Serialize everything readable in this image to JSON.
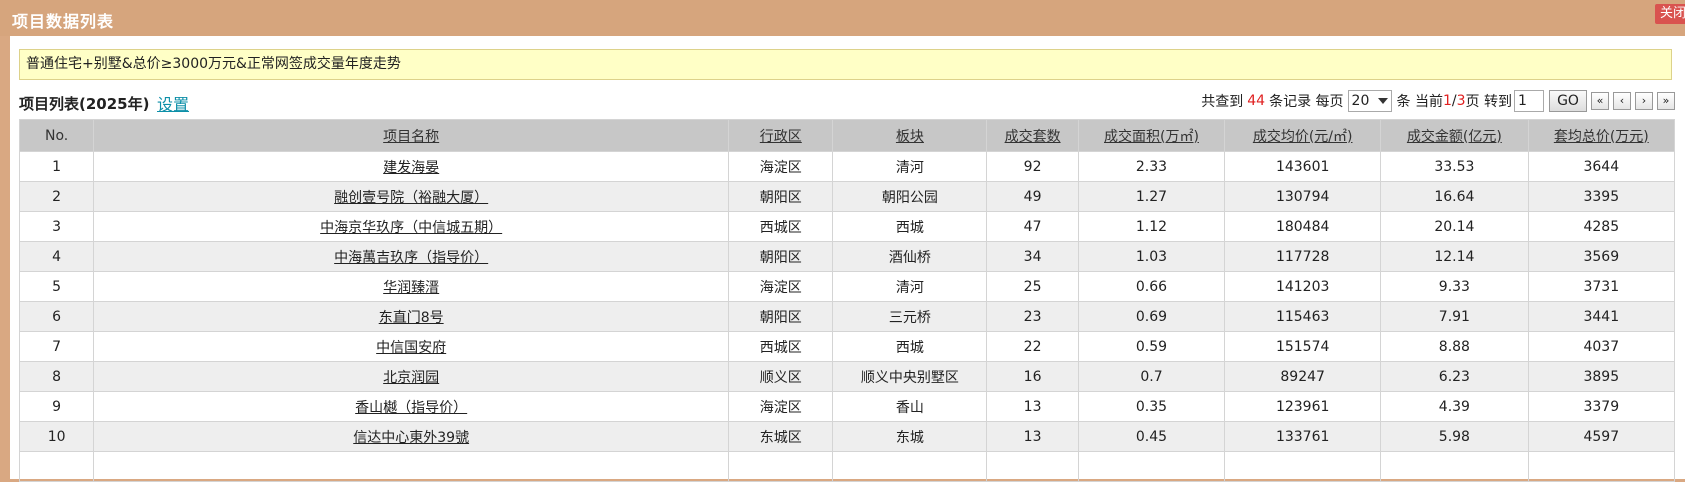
{
  "window": {
    "title": "项目数据列表",
    "close_label": "关闭"
  },
  "subtitle": "普通住宅+别墅&总价≥3000万元&正常网签成交量年度走势",
  "list": {
    "title": "项目列表(2025年)",
    "settings_label": "设置"
  },
  "pager": {
    "found_prefix": "共查到",
    "total": "44",
    "records_suffix": "条记录 每页",
    "per_page": "20",
    "per_page_suffix": "条 当前",
    "current_page": "1",
    "slash": "/",
    "total_pages": "3",
    "page_suffix": "页 转到",
    "goto_value": "1",
    "go_label": "GO",
    "nav": [
      "«",
      "‹",
      "›",
      "»"
    ]
  },
  "table": {
    "headers": [
      "No.",
      "项目名称",
      "行政区",
      "板块",
      "成交套数",
      "成交面积(万㎡)",
      "成交均价(元/㎡)",
      "成交金额(亿元)",
      "套均总价(万元)"
    ],
    "rows": [
      [
        "1",
        "建发海晏",
        "海淀区",
        "清河",
        "92",
        "2.33",
        "143601",
        "33.53",
        "3644"
      ],
      [
        "2",
        "融创壹号院（裕融大厦）",
        "朝阳区",
        "朝阳公园",
        "49",
        "1.27",
        "130794",
        "16.64",
        "3395"
      ],
      [
        "3",
        "中海京华玖序（中信城五期）",
        "西城区",
        "西城",
        "47",
        "1.12",
        "180484",
        "20.14",
        "4285"
      ],
      [
        "4",
        "中海萬吉玖序（指导价）",
        "朝阳区",
        "酒仙桥",
        "34",
        "1.03",
        "117728",
        "12.14",
        "3569"
      ],
      [
        "5",
        "华润臻溍",
        "海淀区",
        "清河",
        "25",
        "0.66",
        "141203",
        "9.33",
        "3731"
      ],
      [
        "6",
        "东直门8号",
        "朝阳区",
        "三元桥",
        "23",
        "0.69",
        "115463",
        "7.91",
        "3441"
      ],
      [
        "7",
        "中信国安府",
        "西城区",
        "西城",
        "22",
        "0.59",
        "151574",
        "8.88",
        "4037"
      ],
      [
        "8",
        "北京润园",
        "顺义区",
        "顺义中央别墅区",
        "16",
        "0.7",
        "89247",
        "6.23",
        "3895"
      ],
      [
        "9",
        "香山樾（指导价）",
        "海淀区",
        "香山",
        "13",
        "0.35",
        "123961",
        "4.39",
        "3379"
      ],
      [
        "10",
        "信达中心東外39號",
        "东城区",
        "东城",
        "13",
        "0.45",
        "133761",
        "5.98",
        "4597"
      ],
      [
        "",
        "",
        "",
        "",
        "",
        "",
        "",
        "",
        ""
      ]
    ]
  }
}
